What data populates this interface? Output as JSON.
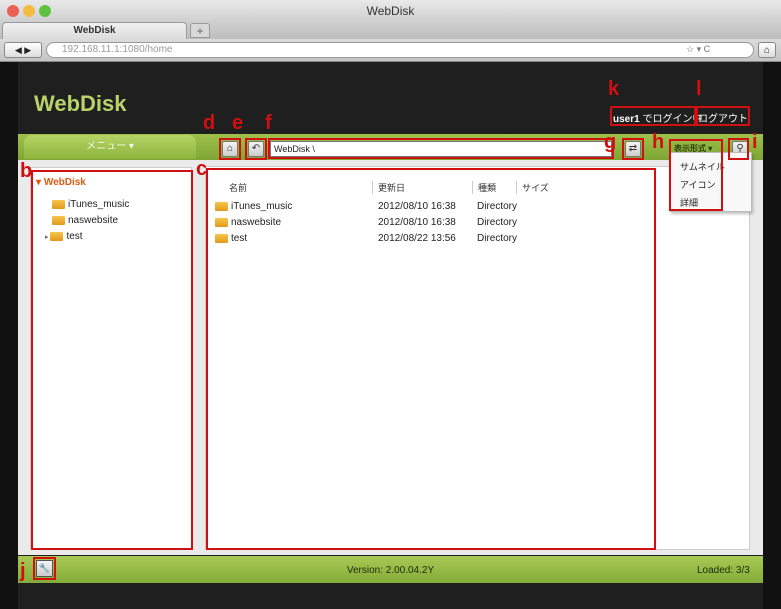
{
  "browser": {
    "window_title": "WebDisk",
    "tab_title": "WebDisk",
    "new_tab": "+",
    "url": "192.168.11.1:1080/home",
    "nav_back_forward": "◀ ▶",
    "url_right": "☆ ▾ C",
    "home": "⌂"
  },
  "app": {
    "logo": "WebDisk",
    "user": "user1",
    "logged_in_text": "でログイン中",
    "logout": "ログアウト",
    "menu_label": "メニュー ▾",
    "path": "WebDisk \\",
    "view_mode_label": "表示形式 ▾",
    "view_mode_options": [
      "サムネイル",
      "アイコン",
      "詳細"
    ],
    "home_icon_glyph": "⌂",
    "back_icon_glyph": "↶",
    "refresh_icon_glyph": "⇄",
    "search_icon_glyph": "⚲",
    "settings_icon_glyph": "🔧"
  },
  "tree": {
    "root": "WebDisk",
    "items": [
      "iTunes_music",
      "naswebsite",
      "test"
    ]
  },
  "files": {
    "columns": [
      "名前",
      "更新日",
      "種類",
      "サイズ"
    ],
    "rows": [
      {
        "name": "iTunes_music",
        "date": "2012/08/10 16:38",
        "type": "Directory"
      },
      {
        "name": "naswebsite",
        "date": "2012/08/10 16:38",
        "type": "Directory"
      },
      {
        "name": "test",
        "date": "2012/08/22 13:56",
        "type": "Directory"
      }
    ]
  },
  "status": {
    "version": "Version: 2.00.04.2Y",
    "loaded": "Loaded: 3/3"
  },
  "annotations": {
    "b": "b",
    "c": "c",
    "d": "d",
    "e": "e",
    "f": "f",
    "g": "g",
    "h": "h",
    "i": "i",
    "j": "j",
    "k": "k",
    "l": "l"
  },
  "colors": {
    "accent_green": "#9fc14c",
    "logo_green": "#b7d36a",
    "annotation_red": "#d01010",
    "tree_root_orange": "#e05a10"
  }
}
